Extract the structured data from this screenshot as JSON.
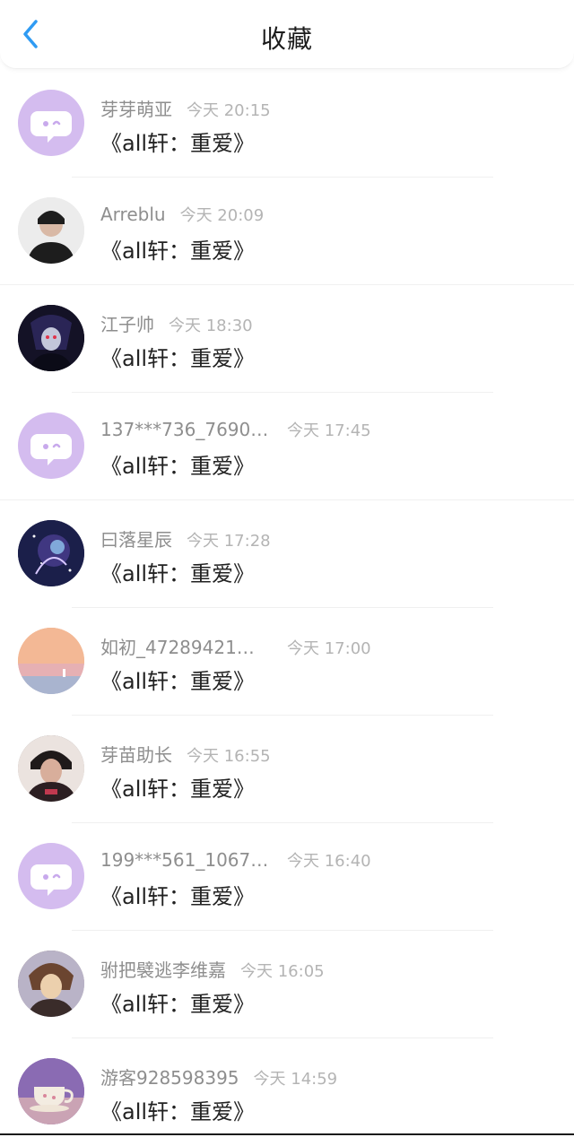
{
  "header": {
    "title": "收藏",
    "back_icon": "chevron-left-icon",
    "accent_color": "#2f9bf3"
  },
  "items": [
    {
      "username": "芽芽萌亚",
      "time": "今天 20:15",
      "content": "《all轩：重爱》",
      "avatar": "default-avatar"
    },
    {
      "username": "Arreblu",
      "time": "今天 20:09",
      "content": "《all轩：重爱》",
      "avatar": "user-photo"
    },
    {
      "username": "江子帅",
      "time": "今天 18:30",
      "content": "《all轩：重爱》",
      "avatar": "user-photo"
    },
    {
      "username": "137***736_7690…",
      "time": "今天 17:45",
      "content": "《all轩：重爱》",
      "avatar": "default-avatar"
    },
    {
      "username": "曰落星辰",
      "time": "今天 17:28",
      "content": "《all轩：重爱》",
      "avatar": "user-photo"
    },
    {
      "username": "如初_47289421…",
      "time": "今天 17:00",
      "content": "《all轩：重爱》",
      "avatar": "user-photo"
    },
    {
      "username": "芽苗助长",
      "time": "今天 16:55",
      "content": "《all轩：重爱》",
      "avatar": "user-photo"
    },
    {
      "username": "199***561_1067…",
      "time": "今天 16:40",
      "content": "《all轩：重爱》",
      "avatar": "default-avatar"
    },
    {
      "username": "驸把襞逃李维嘉",
      "time": "今天 16:05",
      "content": "《all轩：重爱》",
      "avatar": "user-photo"
    },
    {
      "username": "游客928598395",
      "time": "今天 14:59",
      "content": "《all轩：重爱》",
      "avatar": "user-photo"
    }
  ]
}
